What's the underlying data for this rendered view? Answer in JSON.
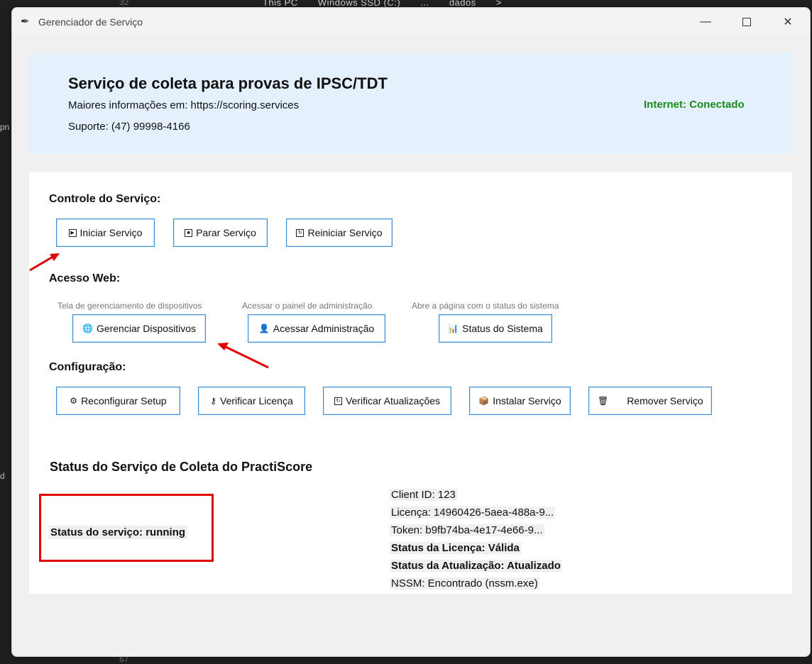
{
  "window": {
    "title": "Gerenciador de Serviço"
  },
  "header": {
    "title": "Serviço de coleta para provas de IPSC/TDT",
    "info": "Maiores informações em: https://scoring.services",
    "support": "Suporte: (47) 99998-4166",
    "internet_status": "Internet: Conectado",
    "internet_color": "#1a8a1a"
  },
  "control": {
    "title": "Controle do Serviço:",
    "start_label": "Iniciar Serviço",
    "stop_label": "Parar Serviço",
    "restart_label": "Reiniciar Serviço"
  },
  "web": {
    "title": "Acesso Web:",
    "devices_hint": "Tela de gerenciamento de dispositivos",
    "devices_label": "Gerenciar Dispositivos",
    "admin_hint": "Acessar o painel de administração",
    "admin_label": "Acessar Administração",
    "status_hint": "Abre a página com o status do sistema",
    "status_label": "Status do Sistema"
  },
  "config": {
    "title": "Configuração:",
    "reconfigure_label": "Reconfigurar Setup",
    "license_label": "Verificar Licença",
    "updates_label": "Verificar Atualizações",
    "install_label": "Instalar Serviço",
    "remove_label": "Remover Serviço"
  },
  "status": {
    "title": "Status do Serviço de Coleta do PractiScore",
    "service_status": "Status do serviço: running",
    "client_id": "Client ID: 123",
    "license": "Licença: 14960426-5aea-488a-9...",
    "token": "Token: b9fb74ba-4e17-4e66-9...",
    "license_status": "Status da Licença: Válida",
    "update_status": "Status da Atualização: Atualizado",
    "nssm": "NSSM: Encontrado (nssm.exe)"
  },
  "background": {
    "crumbs": [
      "This PC",
      "Windows SSD (C:)",
      "...",
      "dados",
      ">"
    ],
    "line_top": "32",
    "line_bottom": "67",
    "side_a": "pn",
    "side_b": "d"
  },
  "colors": {
    "accent": "#3b8fd8",
    "annotation": "#e00000",
    "header_bg": "#e4f1fc"
  }
}
